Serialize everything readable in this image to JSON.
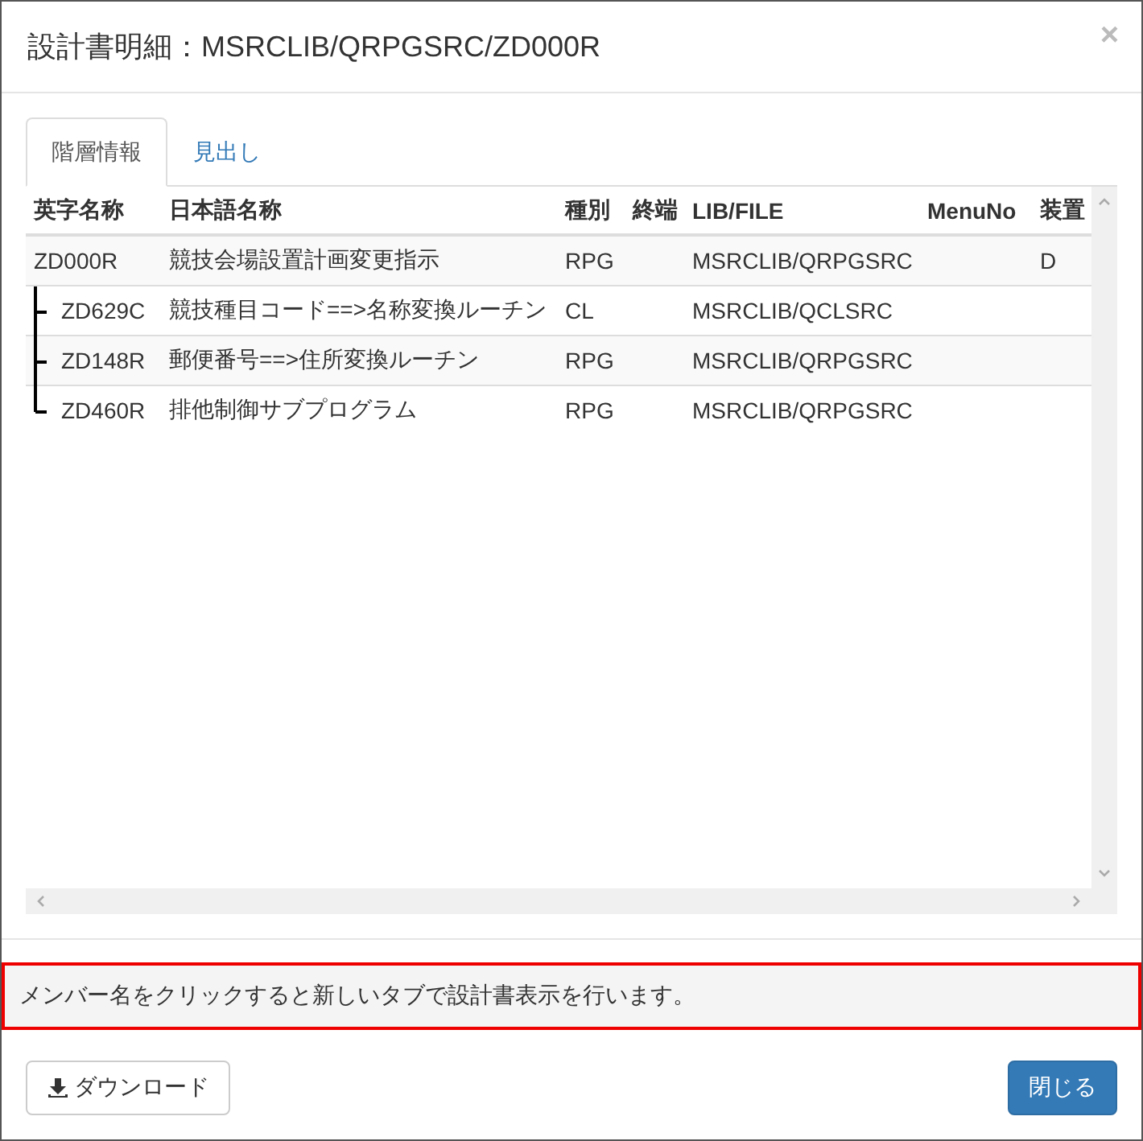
{
  "dialog": {
    "title": "設計書明細：MSRCLIB/QRPGSRC/ZD000R",
    "close": "×"
  },
  "tabs": [
    {
      "label": "階層情報",
      "selected": true
    },
    {
      "label": "見出し",
      "selected": false
    }
  ],
  "table": {
    "columns": [
      "英字名称",
      "日本語名称",
      "種別",
      "終端",
      "LIB/FILE",
      "MenuNo",
      "装置"
    ],
    "rows": [
      {
        "name_en": "ZD000R",
        "name_ja": "競技会場設置計画変更指示",
        "type": "RPG",
        "lib_file": "MSRCLIB/QRPGSRC",
        "device": "D",
        "children": [
          {
            "name_en": "ZD629C",
            "name_ja": "競技種目コード==>名称変換ルーチン",
            "type": "CL",
            "lib_file": "MSRCLIB/QCLSRC"
          },
          {
            "name_en": "ZD148R",
            "name_ja": "郵便番号==>住所変換ルーチン",
            "type": "RPG",
            "lib_file": "MSRCLIB/QRPGSRC"
          },
          {
            "name_en": "ZD460R",
            "name_ja": "排他制御サブプログラム",
            "type": "RPG",
            "lib_file": "MSRCLIB/QRPGSRC"
          }
        ]
      }
    ]
  },
  "notice": "メンバー名をクリックすると新しいタブで設計書表示を行います。",
  "buttons": {
    "download": "ダウンロード",
    "close": "閉じる"
  }
}
